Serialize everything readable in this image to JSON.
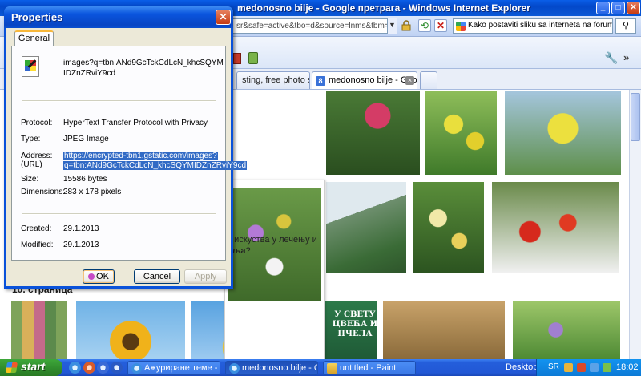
{
  "browser": {
    "title": "medonosno bilje - Google претрага - Windows Internet Explorer",
    "address_text": "sr&safe=active&tbo=d&source=lnms&tbm=isch&",
    "search_text": "Kako postaviti sliku sa interneta na forum",
    "tabs": [
      {
        "label": "sting, free photo sh..."
      },
      {
        "label": "medonosno bilje - Google ..."
      }
    ]
  },
  "page": {
    "snippet_line1": "а искуства у лечењу и",
    "snippet_line2_bold": "иља",
    "snippet_line2_rest": "?",
    "page_number_label": "10. страница",
    "book_title": "У СВЕТУ ЦВЕЋА И ПЧЕЛА"
  },
  "dialog": {
    "title": "Properties",
    "close_glyph": "✕",
    "tab_general": "General",
    "file_name": "images?q=tbn:ANd9GcTckCdLcN_khcSQYMIDZnZRviY9cd",
    "labels": {
      "protocol": "Protocol:",
      "type": "Type:",
      "address": "Address:",
      "address_sub": "(URL)",
      "size": "Size:",
      "dimensions": "Dimensions:",
      "created": "Created:",
      "modified": "Modified:"
    },
    "values": {
      "protocol": "HyperText Transfer Protocol with Privacy",
      "type": "JPEG Image",
      "address_line1": "https://encrypted-tbn1.gstatic.com/images?",
      "address_line2": "q=tbn:ANd9GcTckCdLcN_khcSQYMIDZnZRviY9cd",
      "size": "15586 bytes",
      "dimensions": "283  x  178  pixels",
      "created": "29.1.2013",
      "modified": "29.1.2013"
    },
    "buttons": {
      "ok": "OK",
      "cancel": "Cancel",
      "apply": "Apply"
    }
  },
  "taskbar": {
    "start": "start",
    "tasks": [
      {
        "label": "Ажуриране теме - W..."
      },
      {
        "label": "medonosno bilje - Go..."
      },
      {
        "label": "untitled - Paint"
      }
    ],
    "desktop": "Desktop",
    "language": "SR",
    "clock": "18:02"
  },
  "colors": {
    "titlebar_blue": "#0a52da",
    "selection_blue": "#316ac5",
    "dialog_face": "#ece9d8",
    "start_green": "#2f8a2c"
  }
}
